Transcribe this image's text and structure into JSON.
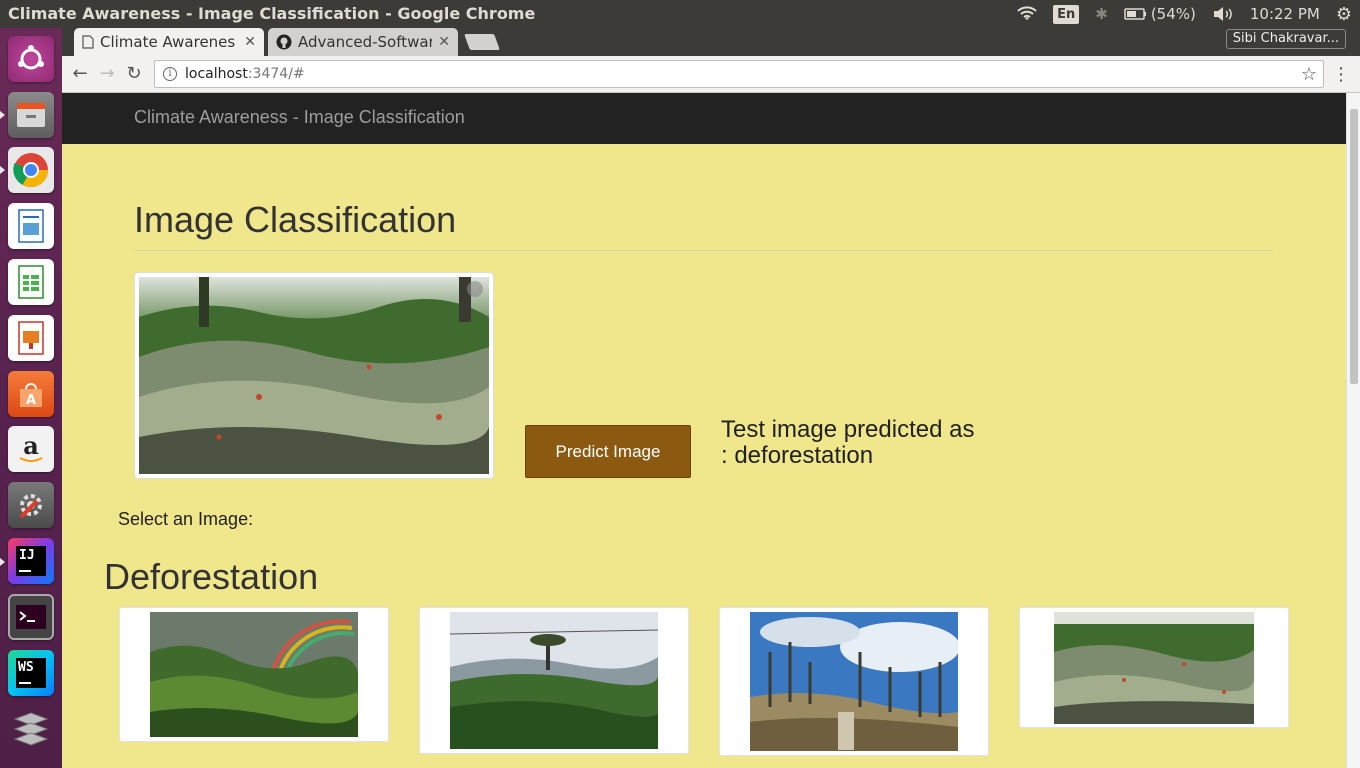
{
  "system": {
    "window_title": "Climate Awareness - Image Classification - Google Chrome",
    "keyboard": "En",
    "battery": "(54%)",
    "clock": "10:22 PM"
  },
  "browser": {
    "tabs": [
      {
        "label": "Climate Awarenes",
        "active": true
      },
      {
        "label": "Advanced-Softwar",
        "active": false
      }
    ],
    "profile": "Sibi Chakravar...",
    "url_host": "localhost",
    "url_path": ":3474/#"
  },
  "page": {
    "brand": "Climate Awareness - Image Classification",
    "heading": "Image Classification",
    "predict_button": "Predict Image",
    "prediction_line1": "Test image predicted as",
    "prediction_line2": ": deforestation",
    "select_label": "Select an Image:",
    "section": "Deforestation"
  },
  "colors": {
    "page_bg": "#f0e68c",
    "navbar_bg": "#222222",
    "button_bg": "#8b5a10"
  },
  "launcher": [
    "ubuntu-icon",
    "files-icon",
    "chrome-icon",
    "writer-icon",
    "calc-icon",
    "impress-icon",
    "software-center-icon",
    "amazon-icon",
    "settings-icon",
    "intellij-icon",
    "terminal-icon",
    "webstorm-icon",
    "workspaces-icon"
  ]
}
